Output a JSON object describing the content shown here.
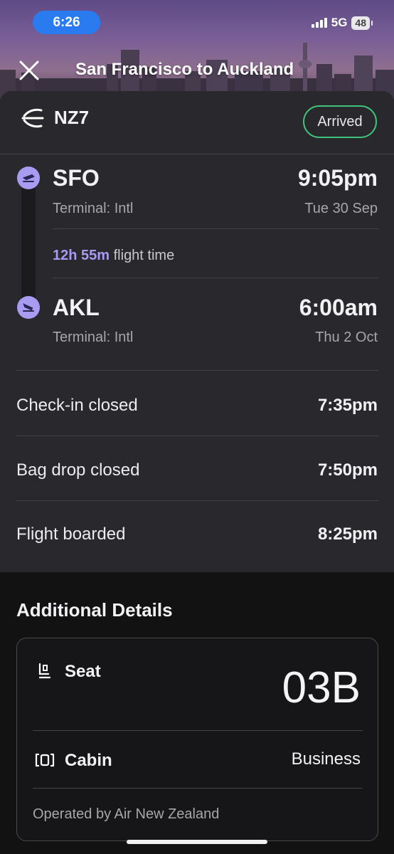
{
  "status_bar": {
    "time": "6:26",
    "network": "5G",
    "battery": "48"
  },
  "header": {
    "title": "San Francisco to Auckland"
  },
  "flight": {
    "number": "NZ7",
    "status": "Arrived",
    "departure": {
      "code": "SFO",
      "time": "9:05pm",
      "terminal": "Terminal: Intl",
      "date": "Tue 30 Sep"
    },
    "duration_value": "12h 55m",
    "duration_suffix": " flight time",
    "arrival": {
      "code": "AKL",
      "time": "6:00am",
      "terminal": "Terminal: Intl",
      "date": "Thu 2 Oct"
    }
  },
  "milestones": [
    {
      "label": "Check-in closed",
      "value": "7:35pm"
    },
    {
      "label": "Bag drop closed",
      "value": "7:50pm"
    },
    {
      "label": "Flight boarded",
      "value": "8:25pm"
    }
  ],
  "additional": {
    "title": "Additional Details",
    "seat_label": "Seat",
    "seat_value": "03B",
    "cabin_label": "Cabin",
    "cabin_value": "Business",
    "operated_by": "Operated by Air New Zealand"
  },
  "colors": {
    "accent": "#a89bf2",
    "status_green": "#3fc27a",
    "card": "#29282c",
    "status_time_bg": "#2b7bf0"
  },
  "icons": [
    "close-icon",
    "airline-logo-icon",
    "takeoff-icon",
    "landing-icon",
    "seat-icon",
    "cabin-icon"
  ]
}
